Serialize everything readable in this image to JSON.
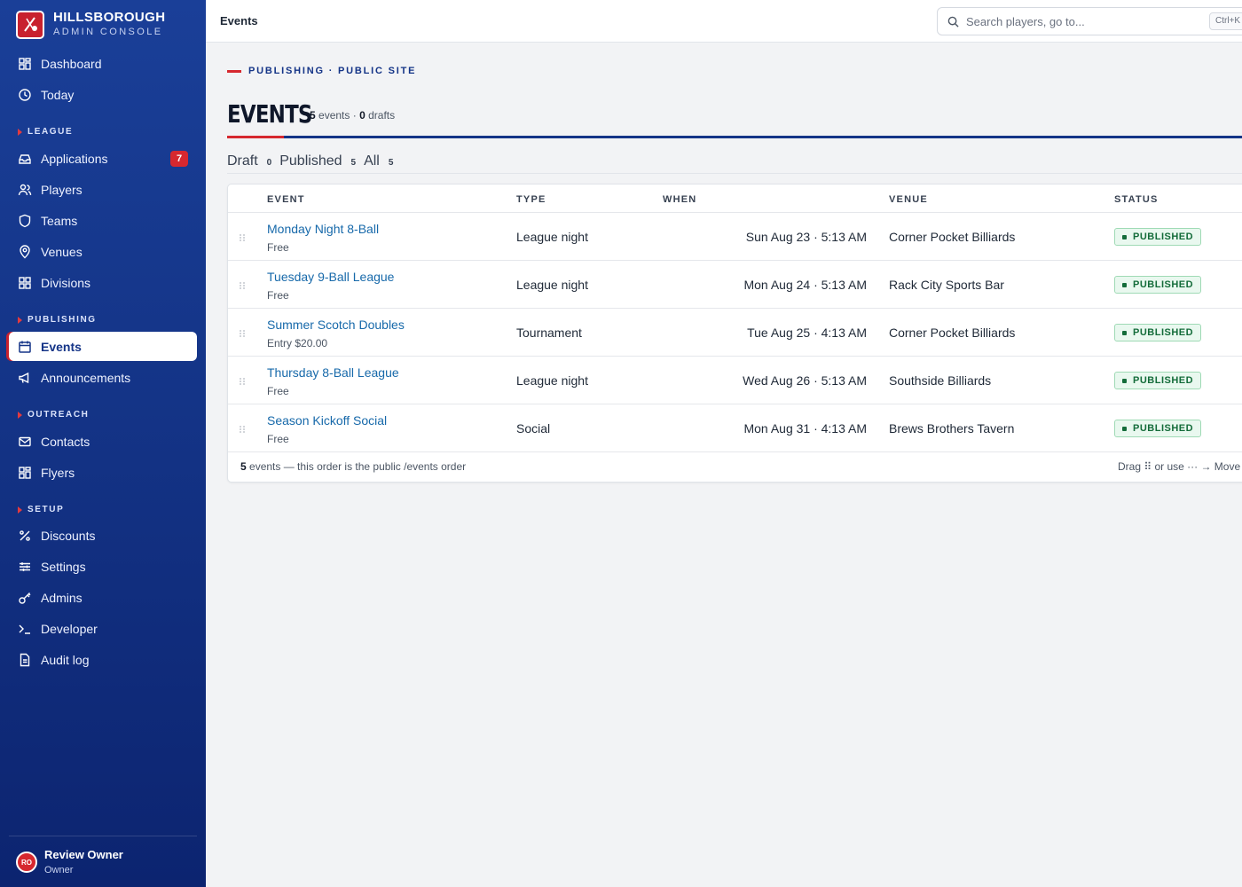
{
  "brand": {
    "name": "HILLSBOROUGH",
    "subtitle": "ADMIN CONSOLE"
  },
  "sidebar": {
    "items": [
      {
        "label": "Dashboard",
        "icon": "grid-icon"
      },
      {
        "label": "Today",
        "icon": "clock-icon"
      },
      {
        "label": "Applications",
        "icon": "inbox-icon",
        "badge": "7"
      },
      {
        "label": "Players",
        "icon": "users-icon"
      },
      {
        "label": "Teams",
        "icon": "shield-icon"
      },
      {
        "label": "Venues",
        "icon": "map-pin-icon"
      },
      {
        "label": "Divisions",
        "icon": "grid-icon"
      },
      {
        "label": "Events",
        "icon": "calendar-icon",
        "active": true
      },
      {
        "label": "Announcements",
        "icon": "megaphone-icon"
      },
      {
        "label": "Contacts",
        "icon": "mail-icon"
      },
      {
        "label": "Flyers",
        "icon": "grid-icon"
      },
      {
        "label": "Discounts",
        "icon": "percent-icon"
      },
      {
        "label": "Settings",
        "icon": "sliders-icon"
      },
      {
        "label": "Admins",
        "icon": "key-icon"
      },
      {
        "label": "Developer",
        "icon": "terminal-icon"
      },
      {
        "label": "Audit log",
        "icon": "file-icon"
      }
    ],
    "sections": [
      "LEAGUE",
      "PUBLISHING",
      "OUTREACH",
      "SETUP"
    ],
    "user": {
      "initials": "RO",
      "name": "Review Owner",
      "role": "Owner"
    }
  },
  "topbar": {
    "title": "Events",
    "search_placeholder": "Search players, go to...",
    "shortcut": "Ctrl+K"
  },
  "header": {
    "eyebrow": "PUBLISHING · PUBLIC SITE",
    "title": "EVENTS",
    "event_count": "5",
    "events_word": "events ·",
    "draft_count": "0",
    "drafts_word": "drafts"
  },
  "tabs": [
    {
      "label": "Draft",
      "count": "0"
    },
    {
      "label": "Published",
      "count": "5"
    },
    {
      "label": "All",
      "count": "5"
    }
  ],
  "table": {
    "columns": [
      "EVENT",
      "TYPE",
      "WHEN",
      "VENUE",
      "STATUS"
    ],
    "rows": [
      {
        "name": "Monday Night 8-Ball",
        "price": "Free",
        "type": "League night",
        "when": "Sun Aug 23 · 5:13 AM",
        "venue": "Corner Pocket Billiards",
        "status": "PUBLISHED"
      },
      {
        "name": "Tuesday 9-Ball League",
        "price": "Free",
        "type": "League night",
        "when": "Mon Aug 24 · 5:13 AM",
        "venue": "Rack City Sports Bar",
        "status": "PUBLISHED"
      },
      {
        "name": "Summer Scotch Doubles",
        "price": "Entry $20.00",
        "type": "Tournament",
        "when": "Tue Aug 25 · 4:13 AM",
        "venue": "Corner Pocket Billiards",
        "status": "PUBLISHED"
      },
      {
        "name": "Thursday 8-Ball League",
        "price": "Free",
        "type": "League night",
        "when": "Wed Aug 26 · 5:13 AM",
        "venue": "Southside Billiards",
        "status": "PUBLISHED"
      },
      {
        "name": "Season Kickoff Social",
        "price": "Free",
        "type": "Social",
        "when": "Mon Aug 31 · 4:13 AM",
        "venue": "Brews Brothers Tavern",
        "status": "PUBLISHED"
      }
    ],
    "footer_count": "5",
    "footer_text": "events — this order is the public /events order",
    "footer_hint": "Drag ⠿ or use ··· → Move t"
  },
  "colors": {
    "brand_blue": "#143487",
    "accent_red": "#d6282f",
    "link": "#1769aa",
    "published_green": "#146c3a"
  }
}
